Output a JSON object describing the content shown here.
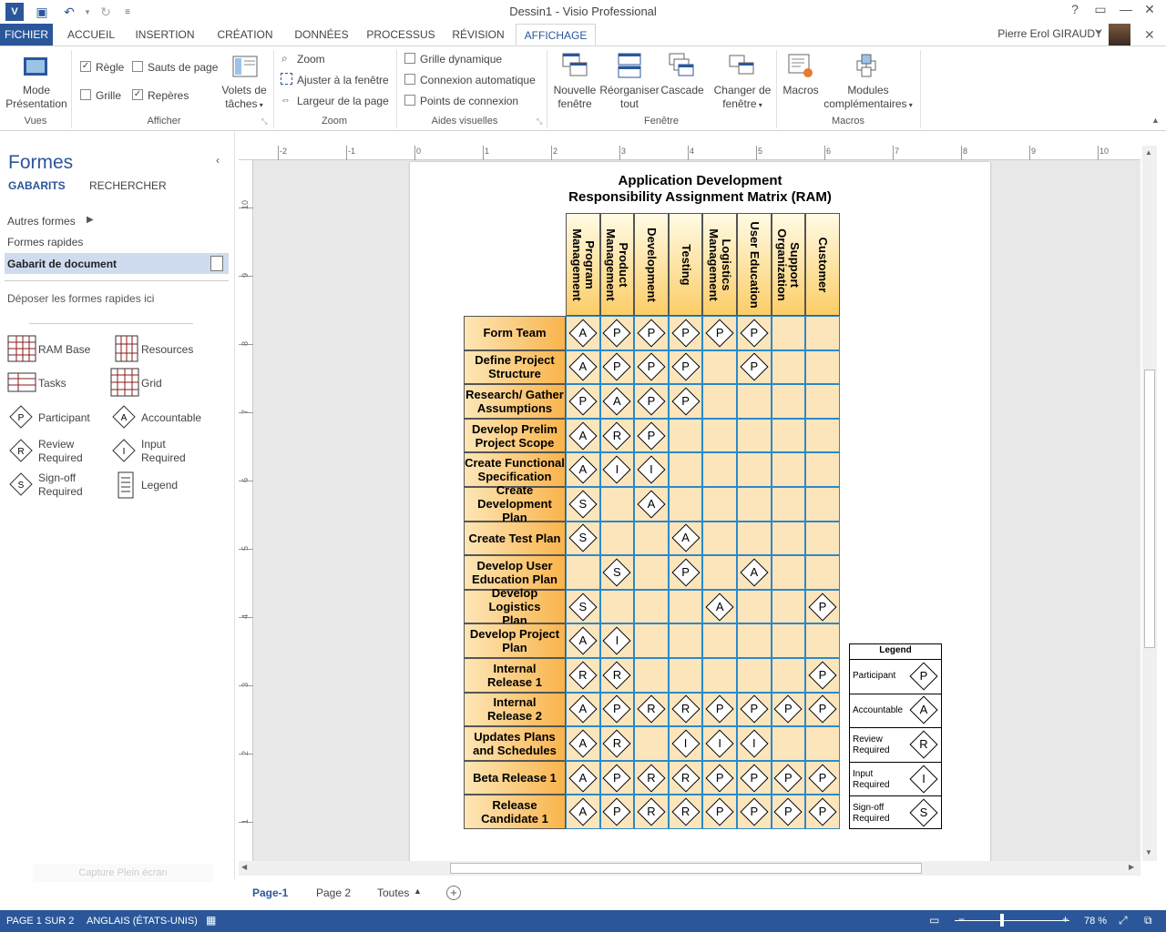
{
  "window": {
    "title": "Dessin1 - Visio Professional",
    "user": "Pierre Erol GIRAUDY"
  },
  "menu": {
    "tabs": [
      "FICHIER",
      "ACCUEIL",
      "INSERTION",
      "CRÉATION",
      "DONNÉES",
      "PROCESSUS",
      "RÉVISION",
      "AFFICHAGE"
    ],
    "active": "AFFICHAGE"
  },
  "ribbon": {
    "vues": {
      "name": "Vues",
      "mode_line1": "Mode",
      "mode_line2": "Présentation"
    },
    "afficher": {
      "name": "Afficher",
      "regle": "Règle",
      "sauts": "Sauts de page",
      "grille": "Grille",
      "reperes": "Repères",
      "volets_line1": "Volets de",
      "volets_line2": "tâches"
    },
    "zoom": {
      "name": "Zoom",
      "zoom": "Zoom",
      "ajuster": "Ajuster à la fenêtre",
      "largeur": "Largeur de la page"
    },
    "aides": {
      "name": "Aides visuelles",
      "grille_dyn": "Grille dynamique",
      "connexion_auto": "Connexion automatique",
      "points": "Points de connexion"
    },
    "fenetre": {
      "name": "Fenêtre",
      "nouvelle_l1": "Nouvelle",
      "nouvelle_l2": "fenêtre",
      "reorg_l1": "Réorganiser",
      "reorg_l2": "tout",
      "cascade": "Cascade",
      "changer_l1": "Changer de",
      "changer_l2": "fenêtre"
    },
    "macros": {
      "name": "Macros",
      "macros": "Macros",
      "modules_l1": "Modules",
      "modules_l2": "complémentaires"
    }
  },
  "shapes_panel": {
    "title": "Formes",
    "tab_gabarits": "GABARITS",
    "tab_rechercher": "RECHERCHER",
    "autres": "Autres formes",
    "rapides": "Formes rapides",
    "gabarit": "Gabarit de document",
    "deposer": "Déposer les formes rapides ici",
    "items": {
      "ram_base": "RAM Base",
      "resources": "Resources",
      "tasks": "Tasks",
      "grid": "Grid",
      "participant": "Participant",
      "accountable": "Accountable",
      "review_l1": "Review",
      "review_l2": "Required",
      "input_l1": "Input",
      "input_l2": "Required",
      "signoff_l1": "Sign-off",
      "signoff_l2": "Required",
      "legend": "Legend"
    },
    "capture": "Capture Plein écran"
  },
  "matrix": {
    "title1": "Application Development",
    "title2": "Responsibility Assignment Matrix (RAM)",
    "columns": [
      "Program\nManagement",
      "Product\nManagement",
      "Development",
      "Testing",
      "Logistics\nManagement",
      "User Education",
      "Support\nOrganization",
      "Customer"
    ],
    "rows": [
      {
        "task": "Form Team",
        "cells": [
          "A",
          "P",
          "P",
          "P",
          "P",
          "P",
          "",
          ""
        ]
      },
      {
        "task": "Define Project\nStructure",
        "cells": [
          "A",
          "P",
          "P",
          "P",
          "",
          "P",
          "",
          ""
        ]
      },
      {
        "task": "Research/ Gather\nAssumptions",
        "cells": [
          "P",
          "A",
          "P",
          "P",
          "",
          "",
          "",
          ""
        ]
      },
      {
        "task": "Develop Prelim\nProject Scope",
        "cells": [
          "A",
          "R",
          "P",
          "",
          "",
          "",
          "",
          ""
        ]
      },
      {
        "task": "Create Functional\nSpecification",
        "cells": [
          "A",
          "I",
          "I",
          "",
          "",
          "",
          "",
          ""
        ]
      },
      {
        "task": "Create\nDevelopment Plan",
        "cells": [
          "S",
          "",
          "A",
          "",
          "",
          "",
          "",
          ""
        ]
      },
      {
        "task": "Create Test Plan",
        "cells": [
          "S",
          "",
          "",
          "A",
          "",
          "",
          "",
          ""
        ]
      },
      {
        "task": "Develop User\nEducation Plan",
        "cells": [
          "",
          "S",
          "",
          "P",
          "",
          "A",
          "",
          ""
        ]
      },
      {
        "task": "Develop Logistics\nPlan",
        "cells": [
          "S",
          "",
          "",
          "",
          "A",
          "",
          "",
          "P"
        ]
      },
      {
        "task": "Develop Project\nPlan",
        "cells": [
          "A",
          "I",
          "",
          "",
          "",
          "",
          "",
          ""
        ]
      },
      {
        "task": "Internal\nRelease 1",
        "cells": [
          "R",
          "R",
          "",
          "",
          "",
          "",
          "",
          "P"
        ]
      },
      {
        "task": "Internal\nRelease 2",
        "cells": [
          "A",
          "P",
          "R",
          "R",
          "P",
          "P",
          "P",
          "P"
        ]
      },
      {
        "task": "Updates Plans\nand Schedules",
        "cells": [
          "A",
          "R",
          "",
          "I",
          "I",
          "I",
          "",
          ""
        ]
      },
      {
        "task": "Beta Release 1",
        "cells": [
          "A",
          "P",
          "R",
          "R",
          "P",
          "P",
          "P",
          "P"
        ]
      },
      {
        "task": "Release\nCandidate 1",
        "cells": [
          "A",
          "P",
          "R",
          "R",
          "P",
          "P",
          "P",
          "P"
        ]
      }
    ],
    "legend": {
      "title": "Legend",
      "items": [
        {
          "label": "Participant",
          "symbol": "P"
        },
        {
          "label": "Accountable",
          "symbol": "A"
        },
        {
          "label": "Review\nRequired",
          "symbol": "R"
        },
        {
          "label": "Input\nRequired",
          "symbol": "I"
        },
        {
          "label": "Sign-off\nRequired",
          "symbol": "S"
        }
      ]
    }
  },
  "ruler": {
    "h": [
      "-2",
      "-1",
      "0",
      "1",
      "2",
      "3",
      "4",
      "5",
      "6",
      "7",
      "8",
      "9",
      "10"
    ],
    "v": [
      "10",
      "9",
      "8",
      "7",
      "6",
      "5",
      "4",
      "3",
      "2",
      "1"
    ]
  },
  "pages": {
    "page1": "Page-1",
    "page2": "Page 2",
    "toutes": "Toutes"
  },
  "status": {
    "page": "PAGE 1 SUR 2",
    "lang": "ANGLAIS (ÉTATS-UNIS)",
    "zoom": "78 %"
  },
  "colors": {
    "accent": "#2b579a",
    "cell": "#fde5bb",
    "grid": "#2b89c8"
  }
}
